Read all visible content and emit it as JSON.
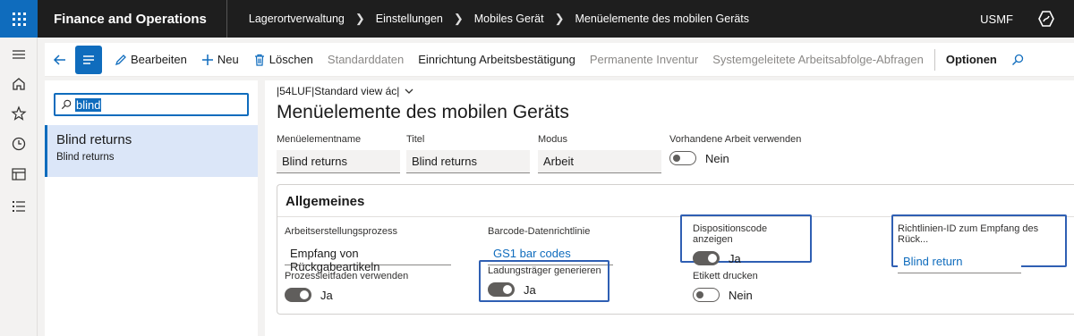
{
  "topbar": {
    "app_name": "Finance and Operations",
    "breadcrumb": [
      "Lagerortverwaltung",
      "Einstellungen",
      "Mobiles Gerät",
      "Menüelemente des mobilen Geräts"
    ],
    "company": "USMF"
  },
  "rail": {
    "icons": [
      "hamburger-icon",
      "home-icon",
      "star-icon",
      "clock-icon",
      "workspace-icon",
      "list-icon"
    ]
  },
  "actions": {
    "edit": "Bearbeiten",
    "new": "Neu",
    "delete": "Löschen",
    "defaults": "Standarddaten",
    "work_confirm": "Einrichtung Arbeitsbestätigung",
    "perpetual_inventory": "Permanente Inventur",
    "system_directed": "Systemgeleitete Arbeitsabfolge-Abfragen",
    "options": "Optionen"
  },
  "list": {
    "search_value": "blind",
    "items": [
      {
        "title": "Blind returns",
        "subtitle": "Blind returns"
      }
    ]
  },
  "main": {
    "view_selector": "|54LUF|Standard view ác|",
    "page_title": "Menüelemente des mobilen Geräts",
    "header": {
      "name_label": "Menüelementname",
      "name_value": "Blind returns",
      "title_label": "Titel",
      "title_value": "Blind returns",
      "mode_label": "Modus",
      "mode_value": "Arbeit",
      "use_existing_label": "Vorhandene Arbeit verwenden",
      "use_existing_value": "Nein"
    },
    "general": {
      "tab_title": "Allgemeines",
      "creation_process_label": "Arbeitserstellungsprozess",
      "creation_process_value": "Empfang von Rückgabeartikeln",
      "guided_label": "Prozessleitfaden verwenden",
      "guided_value": "Ja",
      "barcode_label": "Barcode-Datenrichtlinie",
      "barcode_value": "GS1 bar codes",
      "lp_label": "Ladungsträger generieren",
      "lp_value": "Ja",
      "disposition_label": "Dispositionscode anzeigen",
      "disposition_value": "Ja",
      "print_label_label": "Etikett drucken",
      "print_label_value": "Nein",
      "policy_label": "Richtlinien-ID zum Empfang des Rück...",
      "policy_value": "Blind return"
    }
  },
  "colors": {
    "accent": "#0f6cbd",
    "topbar": "#1e1e1e",
    "highlight": "#2f5fb3"
  }
}
